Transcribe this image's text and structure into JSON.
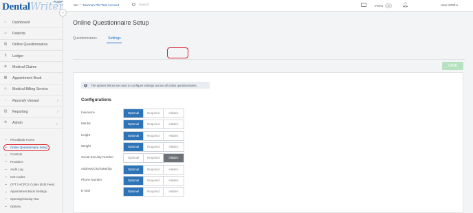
{
  "brand": {
    "name_a": "Dental",
    "name_b": "Writer",
    "plus": "PLUS+"
  },
  "sidebar": {
    "items": [
      {
        "label": "Dashboard",
        "icon": "home-icon"
      },
      {
        "label": "Patients",
        "icon": "patients-icon"
      },
      {
        "label": "Online Questionnaires",
        "icon": "questionnaire-icon"
      },
      {
        "label": "Ledger",
        "icon": "dollar-icon"
      },
      {
        "label": "Medical Claims",
        "icon": "claims-icon"
      },
      {
        "label": "Appointment Book",
        "icon": "calendar-icon"
      },
      {
        "label": "Medical Billing Service",
        "icon": "shield-icon"
      },
      {
        "label": "Recently Viewed",
        "icon": "clock-icon",
        "caret": "›"
      },
      {
        "label": "Reporting",
        "icon": "reporting-icon",
        "caret": "›"
      },
      {
        "label": "Admin",
        "icon": "admin-icon",
        "caret": "⌄"
      }
    ],
    "admin_sub": [
      "Print Blank Forms",
      "Online Questionnaire Setup",
      "Contacts",
      "Providers",
      "Audit Log",
      "ICD Codes",
      "CPT / HCPCS Codes (Edit Fees)",
      "Appointment Book Settings",
      "Opening/Closing Text",
      "Options"
    ]
  },
  "topbar": {
    "we_prefix": "We",
    "account": "Nierman PM Test Account",
    "search_placeholder": "Search",
    "tasks_label": "TASKS",
    "tasks_count": "0",
    "user": "User-9760"
  },
  "page": {
    "title": "Online Questionnaire Setup",
    "tabs": [
      "Questionnaires",
      "Settings"
    ],
    "active_tab": "Settings",
    "save_label": "SAVE",
    "info_text": "The options below are used to configure settings across all online questionnaires.",
    "config_title": "Configurations",
    "options": [
      "Optional",
      "Required",
      "Hidden"
    ],
    "rows": [
      {
        "label": "Insurance",
        "selected": "Optional"
      },
      {
        "label": "Marital",
        "selected": "Optional"
      },
      {
        "label": "Height",
        "selected": "Optional"
      },
      {
        "label": "Weight",
        "selected": "Optional"
      },
      {
        "label": "Social Security Number",
        "selected": "Hidden"
      },
      {
        "label": "Address/City/State/Zip",
        "selected": "Optional"
      },
      {
        "label": "Phone Number",
        "selected": "Optional"
      },
      {
        "label": "E-mail",
        "selected": "Optional"
      }
    ]
  },
  "colors": {
    "accent": "#2d73b8",
    "annotation": "#d51a24",
    "save_disabled": "#b6e2c1"
  }
}
